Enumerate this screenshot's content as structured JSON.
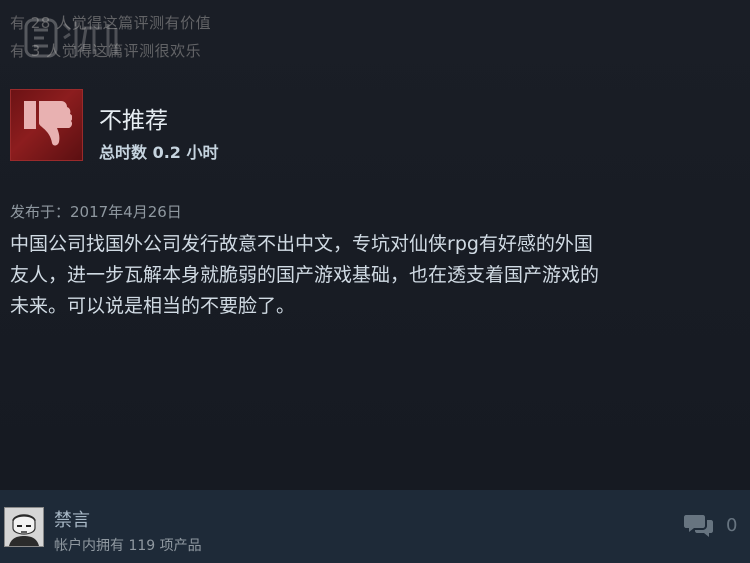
{
  "review": {
    "helpful_line1": "有 28 人觉得这篇评测有价值",
    "helpful_line2": "有 3 人觉得这篇评测很欢乐",
    "verdict": "不推荐",
    "hours": "总时数 0.2 小时",
    "posted": "发布于：2017年4月26日",
    "body_lines": [
      "中国公司找国外公司发行故意不出中文，专坑对仙侠rpg有好感的外国",
      "友人，进一步瓦解本身就脆弱的国产游戏基础，也在透支着国产游戏的",
      "未来。可以说是相当的不要脸了。"
    ],
    "thumb_icon": "thumbs-down-icon"
  },
  "author": {
    "name": "禁言",
    "products": "帐户内拥有 119 项产品",
    "avatar_icon": "avatar"
  },
  "footer": {
    "comment_count": "0",
    "comment_icon": "comment-icon"
  },
  "colors": {
    "background": "#161a22",
    "footer": "#1e2a38",
    "thumb_red": "#8c1d1e",
    "muted": "#626366"
  }
}
